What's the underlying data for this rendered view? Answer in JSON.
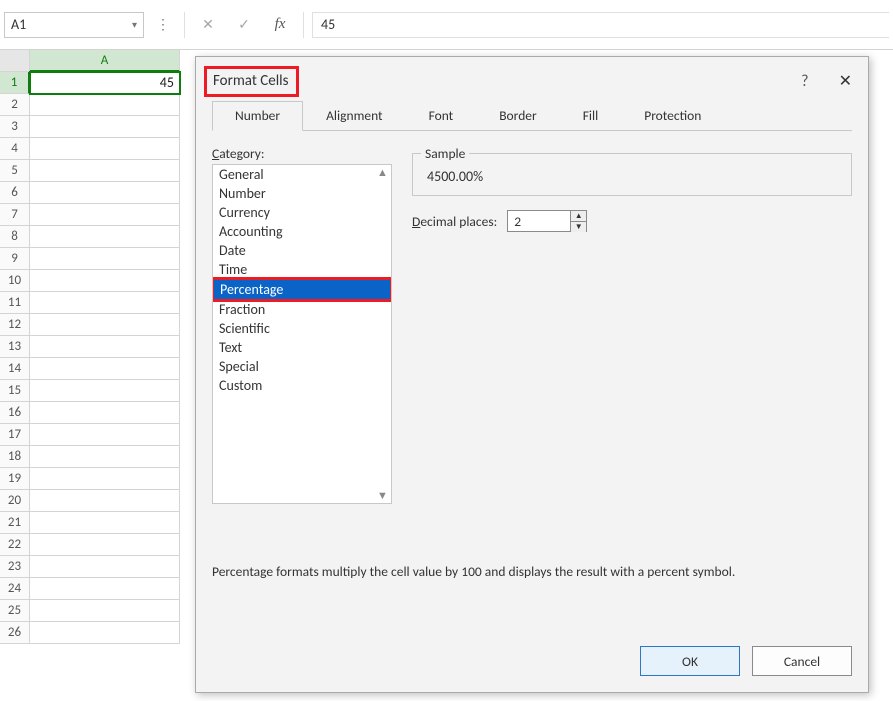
{
  "namebox": {
    "value": "A1"
  },
  "formula_bar": {
    "fx_label": "fx",
    "value": "45"
  },
  "sheet": {
    "col_headers": [
      "A"
    ],
    "rows": 26,
    "active_cell": {
      "row": 1,
      "col": "A",
      "display": "45"
    }
  },
  "dialog": {
    "title": "Format Cells",
    "tabs": [
      "Number",
      "Alignment",
      "Font",
      "Border",
      "Fill",
      "Protection"
    ],
    "active_tab": "Number",
    "category_label_prefix": "C",
    "category_label_rest": "ategory:",
    "categories": [
      "General",
      "Number",
      "Currency",
      "Accounting",
      "Date",
      "Time",
      "Percentage",
      "Fraction",
      "Scientific",
      "Text",
      "Special",
      "Custom"
    ],
    "selected_category": "Percentage",
    "sample_label": "Sample",
    "sample_value": "4500.00%",
    "decimal_label_prefix": "D",
    "decimal_label_rest": "ecimal places:",
    "decimal_value": "2",
    "description": "Percentage formats multiply the cell value by 100 and displays the result with a percent symbol.",
    "ok_label": "OK",
    "cancel_label": "Cancel",
    "help_glyph": "?",
    "close_glyph": "✕"
  },
  "icons": {
    "dropdown": "▾",
    "dots": "⋮",
    "cancel_x": "✕",
    "check": "✓",
    "scroll_up": "▲",
    "scroll_down": "▼"
  }
}
